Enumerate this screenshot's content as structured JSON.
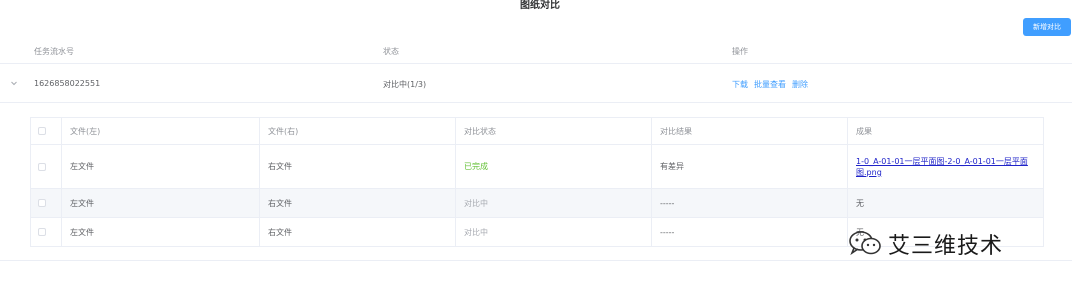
{
  "page": {
    "title": "图纸对比"
  },
  "toolbar": {
    "new_compare_label": "新增对比"
  },
  "outer_table": {
    "headers": {
      "task_no": "任务流水号",
      "status": "状态",
      "actions": "操作"
    },
    "row": {
      "task_no": "1626858022551",
      "status": "对比中(1/3)",
      "actions": {
        "download": "下载",
        "batch_view": "批量查看",
        "delete": "删除"
      }
    }
  },
  "inner_table": {
    "headers": {
      "left": "文件(左)",
      "right": "文件(右)",
      "compare_status": "对比状态",
      "compare_result": "对比结果",
      "output": "成果"
    },
    "rows": [
      {
        "left": "左文件",
        "right": "右文件",
        "compare_status": "已完成",
        "compare_result": "有差异",
        "output": "1-0_A-01-01一层平面图-2-0_A-01-01一层平面图.png"
      },
      {
        "left": "左文件",
        "right": "右文件",
        "compare_status": "对比中",
        "compare_result": "-----",
        "output": "无"
      },
      {
        "left": "左文件",
        "right": "右文件",
        "compare_status": "对比中",
        "compare_result": "-----",
        "output": "无"
      }
    ]
  },
  "watermark": {
    "text": "艾三维技术",
    "icon": "wechat-icon"
  },
  "colors": {
    "primary": "#409eff",
    "success": "#67c23a",
    "muted": "#a8abb2",
    "link": "#1f23c9"
  }
}
